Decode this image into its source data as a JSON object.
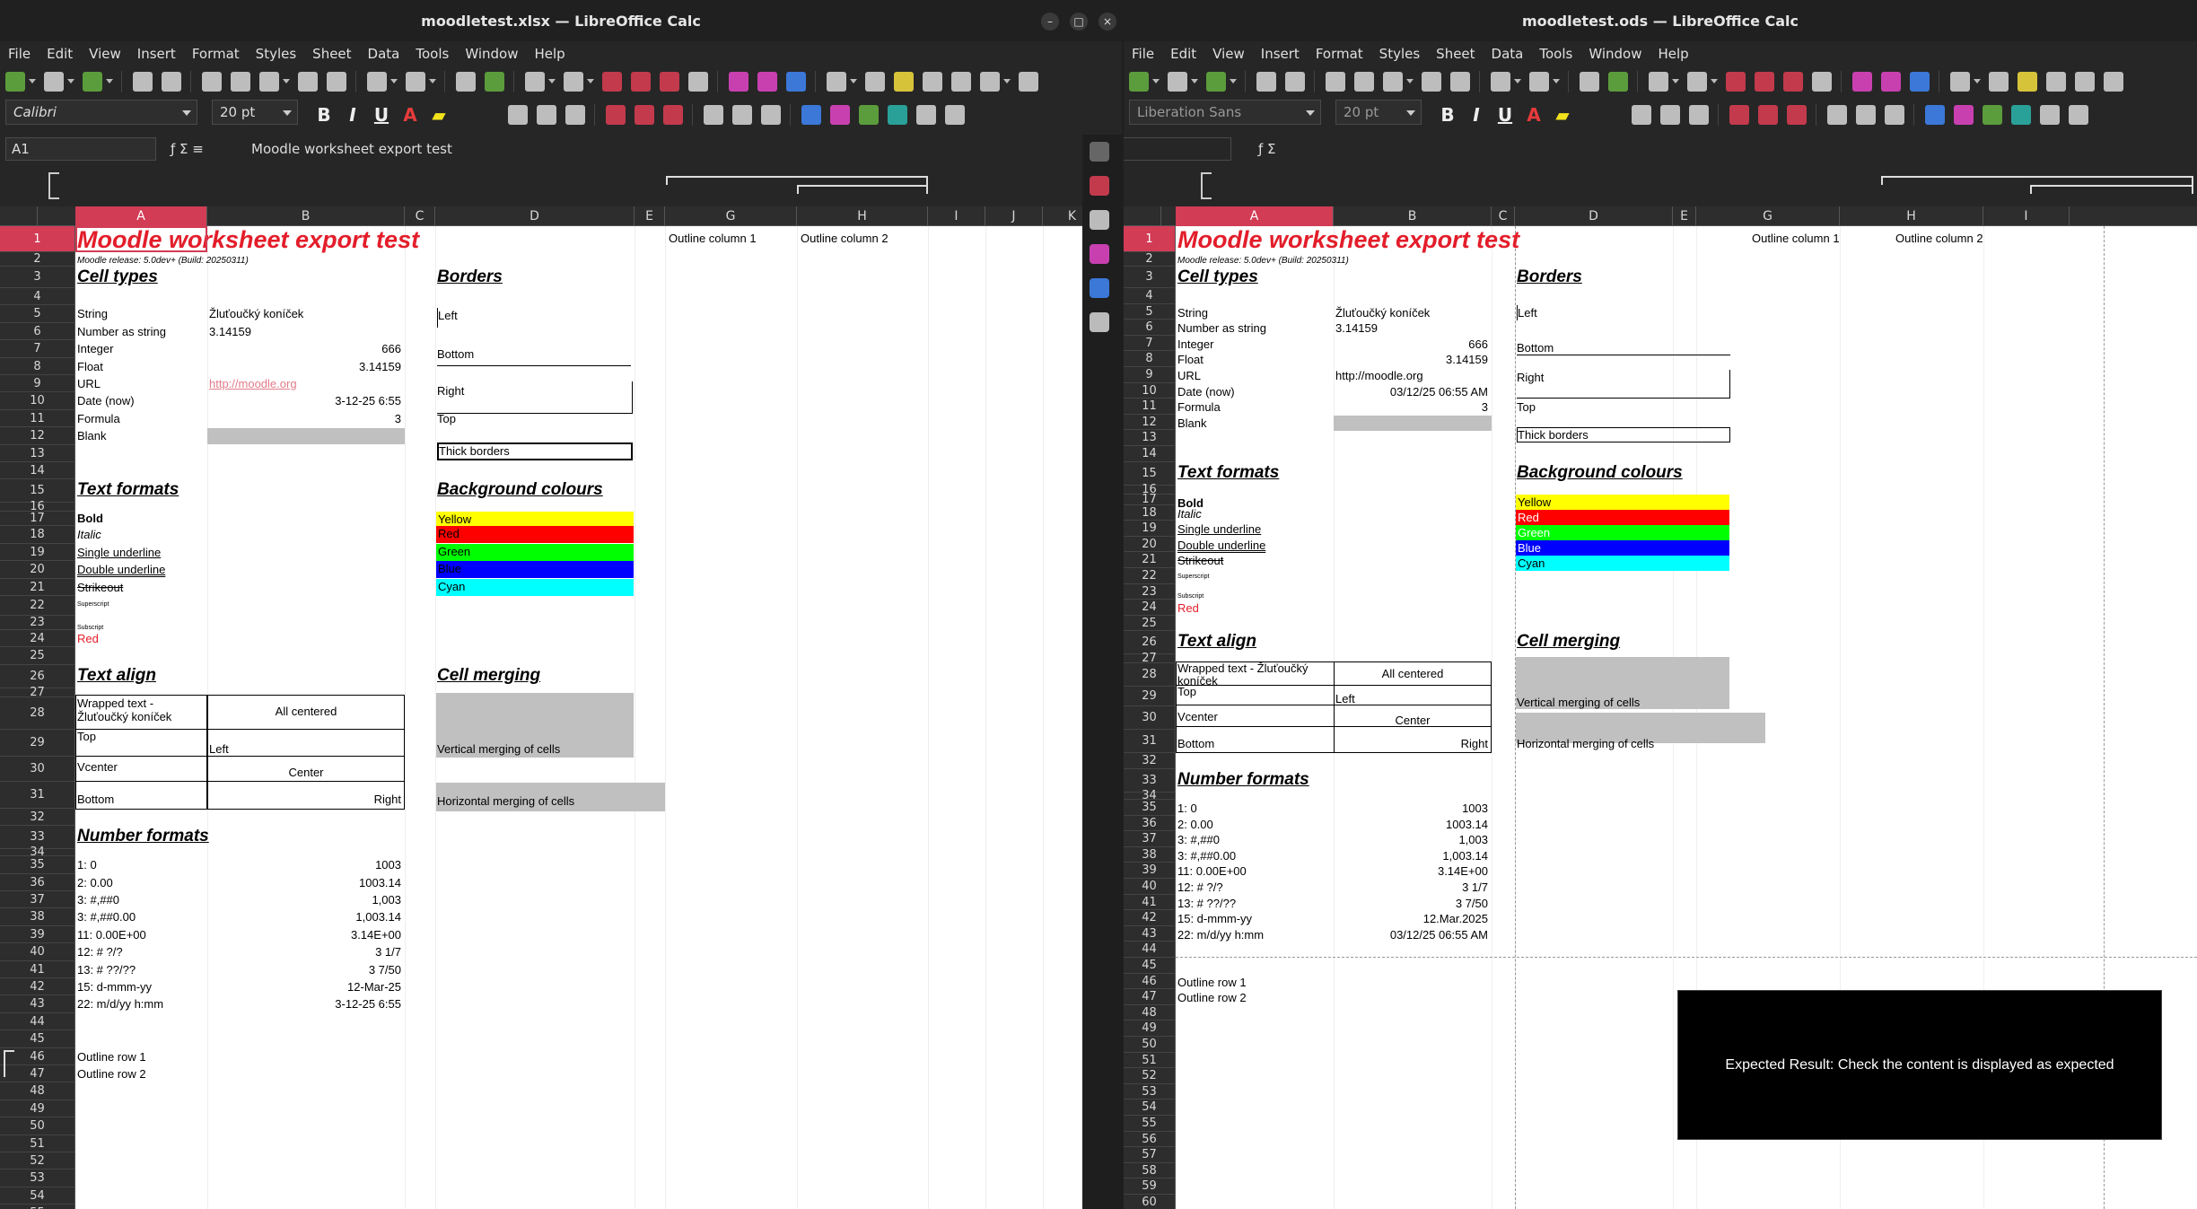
{
  "left": {
    "title": "moodletest.xlsx — LibreOffice Calc",
    "menu": [
      "File",
      "Edit",
      "View",
      "Insert",
      "Format",
      "Styles",
      "Sheet",
      "Data",
      "Tools",
      "Window",
      "Help"
    ],
    "font_name": "Calibri",
    "font_size": "20 pt",
    "name_box": "A1",
    "formula": "Moodle worksheet export test",
    "columns": [
      "A",
      "B",
      "C",
      "D",
      "E",
      "G",
      "H",
      "I",
      "J",
      "K"
    ]
  },
  "right": {
    "title": "moodletest.ods — LibreOffice Calc",
    "menu": [
      "File",
      "Edit",
      "View",
      "Insert",
      "Format",
      "Styles",
      "Sheet",
      "Data",
      "Tools",
      "Window",
      "Help"
    ],
    "font_name": "Liberation Sans",
    "font_size": "20 pt",
    "columns": [
      "A",
      "B",
      "C",
      "D",
      "E",
      "G",
      "H",
      "I"
    ],
    "overlay": "Expected Result: Check the content is displayed as expected"
  },
  "sheet": {
    "title": "Moodle worksheet export test",
    "release": "Moodle release: 5.0dev+ (Build: 20250311)",
    "outline_col1": "Outline column 1",
    "outline_col2": "Outline column 2",
    "cell_types": "Cell types",
    "string_lbl": "String",
    "string_val": "Žluťoučký koníček",
    "numstr_lbl": "Number as string",
    "numstr_val": "3.14159",
    "int_lbl": "Integer",
    "int_val": "666",
    "float_lbl": "Float",
    "float_val": "3.14159",
    "url_lbl": "URL",
    "url_val": "http://moodle.org",
    "date_lbl": "Date (now)",
    "date_val_l": "3-12-25 6:55",
    "date_val_r": "03/12/25 06:55 AM",
    "formula_lbl": "Formula",
    "formula_val": "3",
    "blank_lbl": "Blank",
    "borders": "Borders",
    "b_left": "Left",
    "b_bottom": "Bottom",
    "b_right": "Right",
    "b_top": "Top",
    "b_thick": "Thick borders",
    "text_formats": "Text formats",
    "bold": "Bold",
    "italic": "Italic",
    "single": "Single underline",
    "double": "Double underline",
    "strike": "Strikeout",
    "sup": "Superscript",
    "sub": "Subscript",
    "red": "Red",
    "bg_colours": "Background colours",
    "yellow": "Yellow",
    "redc": "Red",
    "green": "Green",
    "blue": "Blue",
    "cyan": "Cyan",
    "text_align": "Text align",
    "wrapped": "Wrapped text - Žluťoučký koníček",
    "all_centered": "All centered",
    "a_top": "Top",
    "a_left": "Left",
    "a_vcenter": "Vcenter",
    "a_center": "Center",
    "a_bottom": "Bottom",
    "a_right": "Right",
    "cell_merging": "Cell merging",
    "vmerge": "Vertical merging of cells",
    "hmerge": "Horizontal merging of cells",
    "number_formats": "Number formats",
    "nf": [
      {
        "k": "1: 0",
        "l": "1003",
        "r": "1003"
      },
      {
        "k": "2: 0.00",
        "l": "1003.14",
        "r": "1003.14"
      },
      {
        "k": "3: #,##0",
        "l": "1,003",
        "r": "1,003"
      },
      {
        "k": "3: #,##0.00",
        "l": "1,003.14",
        "r": "1,003.14"
      },
      {
        "k": "11: 0.00E+00",
        "l": "3.14E+00",
        "r": "3.14E+00"
      },
      {
        "k": "12: # ?/?",
        "l": "3 1/7",
        "r": "3 1/7"
      },
      {
        "k": "13: # ??/??",
        "l": "3   7/50",
        "r": "3   7/50"
      },
      {
        "k": "15: d-mmm-yy",
        "l": "12-Mar-25",
        "r": "12.Mar.2025"
      },
      {
        "k": "22: m/d/yy h:mm",
        "l": "3-12-25 6:55",
        "r": "03/12/25 06:55 AM"
      }
    ],
    "outline_row1": "Outline row 1",
    "outline_row2": "Outline row 2"
  },
  "colors": {
    "accent": "#d23c55",
    "title_red": "#e31d2a",
    "yellow": "#ffff00",
    "red": "#ff0000",
    "green": "#00ff00",
    "blue": "#0000ff",
    "cyan": "#00ffff",
    "grey": "#c0c0c0"
  }
}
